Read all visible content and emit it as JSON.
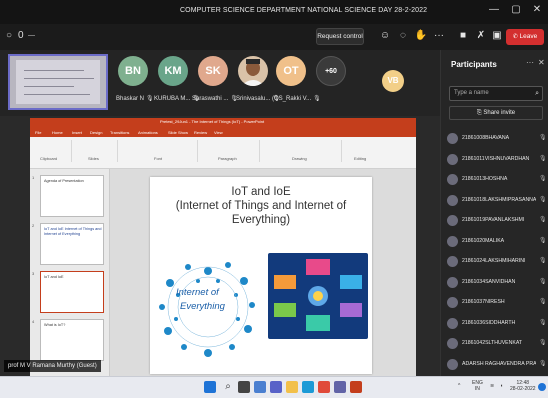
{
  "window": {
    "title": "COMPUTER SCIENCE DEPARTMENT NATIONAL SCIENCE DAY 28-2-2022",
    "minimize": "—",
    "maximize": "▢",
    "close": "✕"
  },
  "toolbar": {
    "timer": "0",
    "request_control": "Request control",
    "leave": "Leave"
  },
  "video_tiles": [
    {
      "initials": "BN",
      "name": "Bhaskar N",
      "color": "#7fb08f"
    },
    {
      "initials": "KM",
      "name": "KURUBA M...",
      "color": "#6aa58a"
    },
    {
      "initials": "SK",
      "name": "Saraswathi ...",
      "color": "#e0a88d"
    },
    {
      "initials": "",
      "name": "Srinivasalu...",
      "color": "#8a6a55"
    },
    {
      "initials": "OT",
      "name": "(OS_Rakki V...",
      "color": "#f0c08a"
    },
    {
      "initials": "+60",
      "name": "",
      "color": "#3a3a3a"
    },
    {
      "initials": "VB",
      "name": "",
      "color": "#f2cf88"
    }
  ],
  "presentation": {
    "window_caption": "Pretest_29Jun1 - The Internet of Things (IoT) - PowerPoint",
    "tabs": [
      "File",
      "Home",
      "Insert",
      "Design",
      "Transitions",
      "Animations",
      "Slide Show",
      "Review",
      "View"
    ],
    "ribbon_groups": [
      "Clipboard",
      "Slides",
      "Font",
      "Paragraph",
      "Drawing",
      "Editing"
    ],
    "slide_title_line1": "IoT and IoE",
    "slide_title_line2": "(Internet of Things and Internet of",
    "slide_title_line3": "Everything)",
    "graphic_text_1": "Internet of",
    "graphic_text_2": "Everything",
    "thumbnails": [
      {
        "num": "1",
        "text": "Agenda of Presentation"
      },
      {
        "num": "2",
        "text": "IoT and IoE\nInternet of Things and Internet of Everything"
      },
      {
        "num": "3",
        "text": "IoT and IoE"
      },
      {
        "num": "4",
        "text": "What is IoT?"
      }
    ]
  },
  "presenter_caption": "prof M V Ramana Murthy (Guest)",
  "participants": {
    "title": "Participants",
    "search_placeholder": "Type a name",
    "share_invite": "Share invite",
    "list": [
      "21861008BHAVANA",
      "21861011VISHNUVARDHAN",
      "21861013HOSHNA",
      "21861018LAKSHMIPRASANNA",
      "21861019PAVANLAKSHMI",
      "21861020MALIKA",
      "21861024LAKSHMIHARINI",
      "21861034SANVIDHAN",
      "21861037NIRESH",
      "21861036SIDDHARTH",
      "21861042SLTHUVENKAT",
      "ADARSH RAGHAVENDRA PRASAD"
    ]
  },
  "taskbar": {
    "lang_line1": "ENG",
    "lang_line2": "IN",
    "time": "12:48",
    "date": "28-02-2022"
  }
}
